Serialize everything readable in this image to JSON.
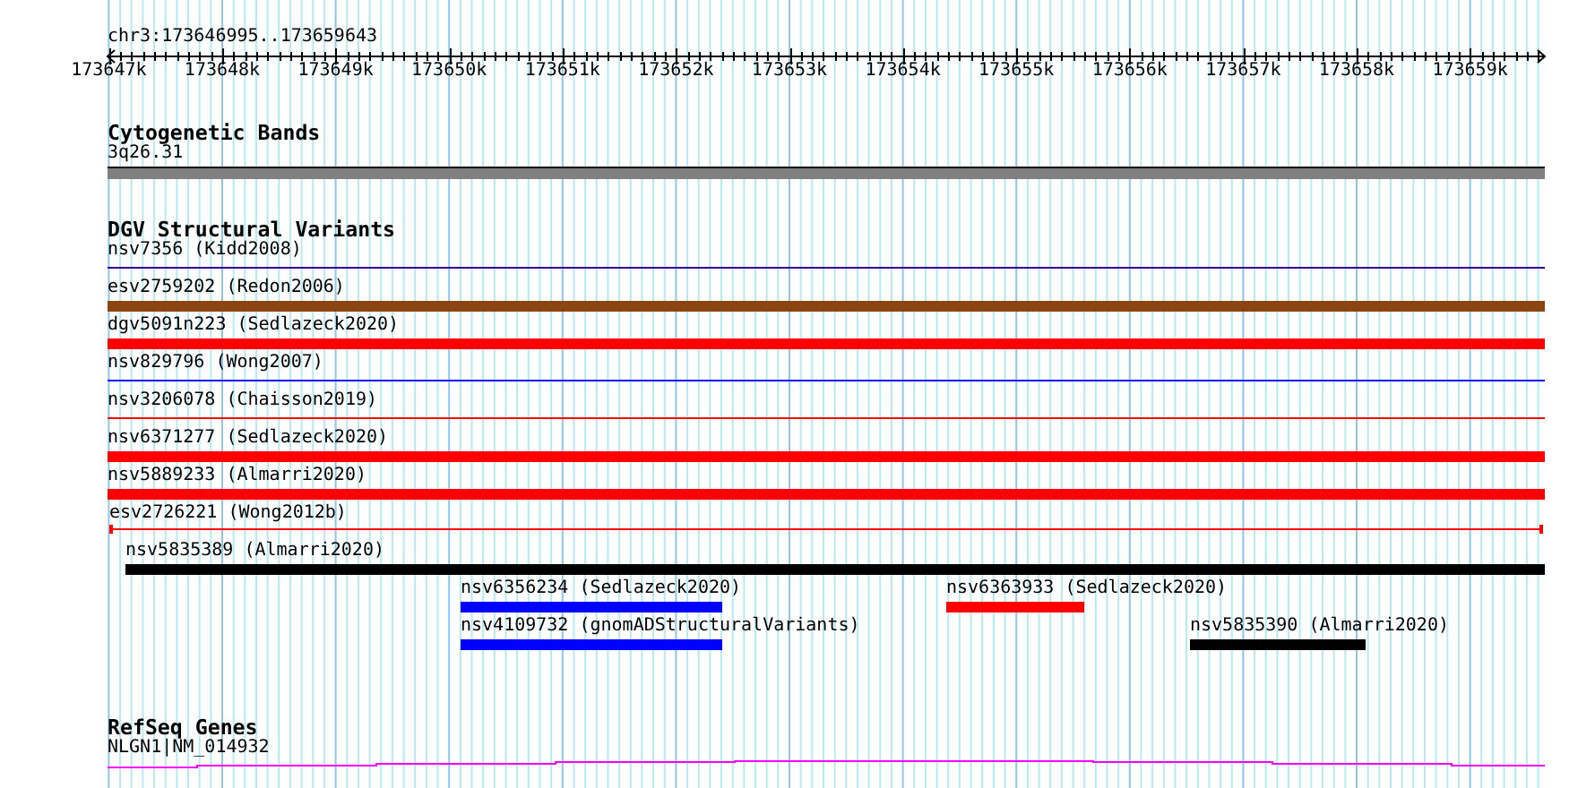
{
  "ruler": {
    "location": "chr3:173646995..173659643",
    "tick_labels": [
      "173647k",
      "173648k",
      "173649k",
      "173650k",
      "173651k",
      "173652k",
      "173653k",
      "173654k",
      "173655k",
      "173656k",
      "173657k",
      "173658k",
      "173659k"
    ]
  },
  "tracks": [
    {
      "title": "Cytogenetic Bands",
      "features": [
        {
          "label": "3q26.31",
          "kind": "band",
          "color": "#808080"
        }
      ]
    },
    {
      "title": "DGV Structural Variants",
      "features": [
        {
          "label": "nsv7356 (Kidd2008)",
          "kind": "line",
          "color": "#330099"
        },
        {
          "label": "esv2759202 (Redon2006)",
          "kind": "bar",
          "color": "#8b4513"
        },
        {
          "label": "dgv5091n223 (Sedlazeck2020)",
          "kind": "bar",
          "color": "#ff0000"
        },
        {
          "label": "nsv829796 (Wong2007)",
          "kind": "line",
          "color": "#0000ff"
        },
        {
          "label": "nsv3206078 (Chaisson2019)",
          "kind": "line",
          "color": "#ff0000"
        },
        {
          "label": "nsv6371277 (Sedlazeck2020)",
          "kind": "bar",
          "color": "#ff0000"
        },
        {
          "label": "nsv5889233 (Almarri2020)",
          "kind": "bar",
          "color": "#ff0000"
        },
        {
          "label": "esv2726221 (Wong2012b)",
          "kind": "span",
          "color": "#ff0000"
        },
        {
          "label": "nsv5835389 (Almarri2020)",
          "kind": "bar",
          "color": "#000000"
        },
        {
          "label": "nsv6356234 (Sedlazeck2020)",
          "kind": "bar",
          "color": "#0000ff"
        },
        {
          "label": "nsv6363933 (Sedlazeck2020)",
          "kind": "bar",
          "color": "#ff0000"
        },
        {
          "label": "nsv4109732 (gnomADStructuralVariants)",
          "kind": "bar",
          "color": "#0000ff"
        },
        {
          "label": "nsv5835390 (Almarri2020)",
          "kind": "bar",
          "color": "#000000"
        }
      ]
    },
    {
      "title": "RefSeq Genes",
      "features": [
        {
          "label": "NLGN1|NM_014932",
          "kind": "gene",
          "color": "#ff00ff"
        }
      ]
    }
  ]
}
